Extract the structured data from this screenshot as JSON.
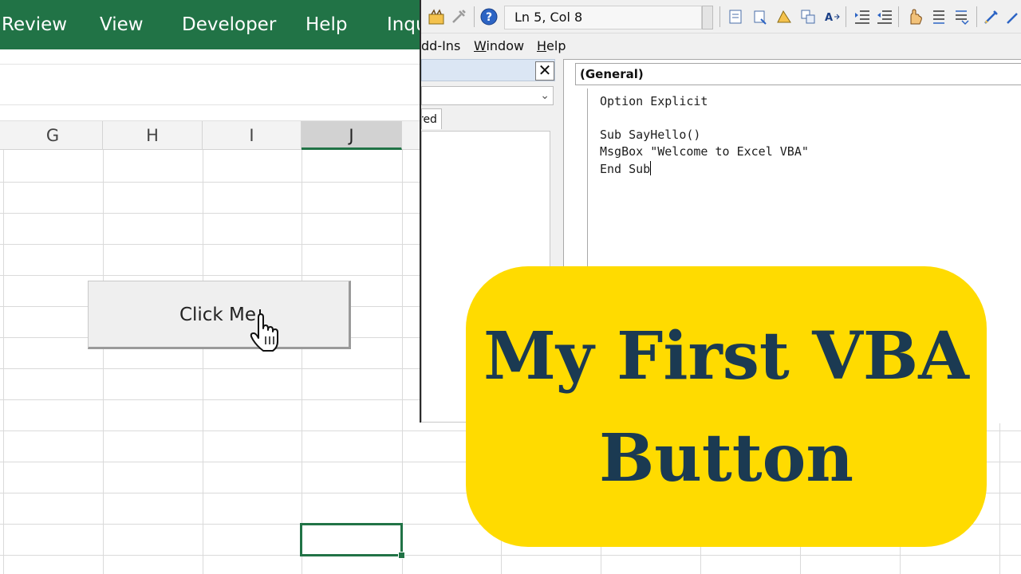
{
  "excel": {
    "ribbon_tabs": [
      "Review",
      "View",
      "Developer",
      "Help",
      "Inqu"
    ],
    "column_headers": [
      "G",
      "H",
      "I",
      "J"
    ],
    "selected_column": "J",
    "form_button": {
      "label": "Click Me"
    },
    "colors": {
      "ribbon": "#217346",
      "selection": "#217346"
    }
  },
  "vbe": {
    "toolbar": {
      "ln_col": "Ln 5, Col 8"
    },
    "menus": [
      {
        "label": "dd-Ins",
        "underline": ""
      },
      {
        "label": "Window",
        "underline": "W"
      },
      {
        "label": "Help",
        "underline": "H"
      }
    ],
    "project_pane": {
      "close_glyph": "✕",
      "tab_label": "red"
    },
    "code": {
      "object_combo": "(General)",
      "lines": [
        "Option Explicit",
        "",
        "Sub SayHello()",
        "MsgBox \"Welcome to Excel VBA\"",
        "End Sub"
      ]
    }
  },
  "banner": {
    "line1": "My First VBA",
    "line2": "Button",
    "colors": {
      "background": "#ffdb00",
      "text": "#1b3a52"
    }
  },
  "icons": [
    "insert-userform-icon",
    "tools-icon",
    "help-icon",
    "indent-icon",
    "outdent-icon",
    "toggle-breakpoint-icon",
    "comment-block-icon",
    "uncomment-block-icon",
    "bookmark-icon",
    "next-bookmark-icon",
    "hand-cursor-icon"
  ]
}
